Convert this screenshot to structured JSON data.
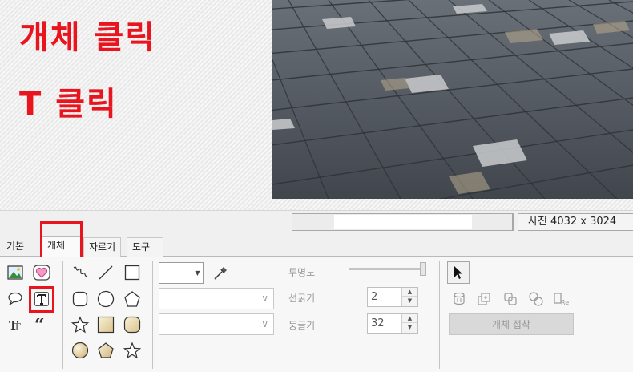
{
  "annotations": {
    "step1": "개체 클릭",
    "step2": "T 클릭"
  },
  "status": {
    "photo_size": "사진 4032 x 3024"
  },
  "tabs": [
    {
      "label": "기본"
    },
    {
      "label": "개체"
    },
    {
      "label": "자르기"
    },
    {
      "label": "도구"
    }
  ],
  "panel": {
    "opacity_label": "투명도",
    "line_width_label": "선굵기",
    "line_width_value": "2",
    "roundness_label": "둥글기",
    "roundness_value": "32",
    "attach_button": "개체 접착"
  },
  "icons": {
    "left_group": [
      "image-icon",
      "heart-sticker-icon",
      "speech-bubble-icon",
      "text-icon",
      "text-effect-icon",
      "quote-icon"
    ],
    "shape_group": [
      "freehand-icon",
      "line-icon",
      "rectangle-icon",
      "rounded-rect-icon",
      "circle-icon",
      "pentagon-icon",
      "star-outline-icon",
      "filled-square-icon",
      "filled-rounded-square-icon",
      "filled-circle-icon",
      "filled-pentagon-icon",
      "star-icon"
    ],
    "right_group": [
      "cursor-icon",
      "object-icon-1",
      "object-icon-2",
      "object-icon-3",
      "object-icon-4",
      "object-reset-icon"
    ]
  },
  "colors": {
    "highlight": "#e8141e",
    "annotation_text": "#e8141e"
  }
}
